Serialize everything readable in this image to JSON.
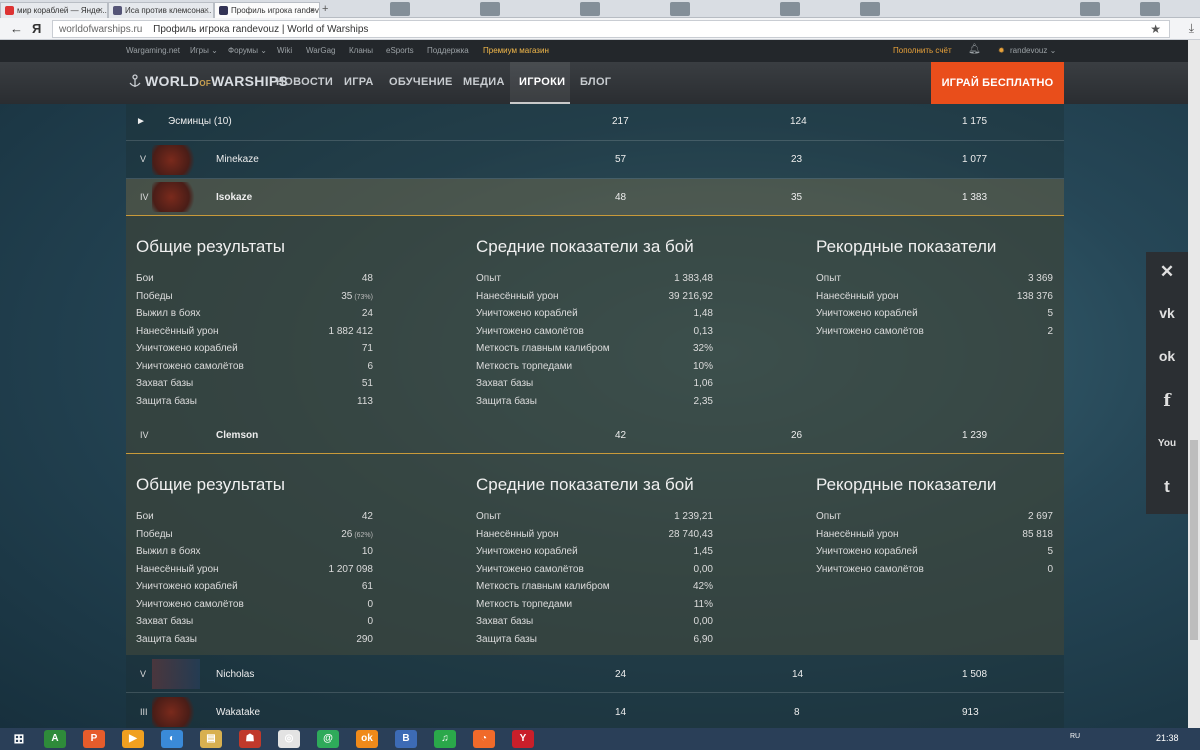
{
  "browser": {
    "tabs": [
      {
        "label": "мир кораблей — Янде...",
        "active": false
      },
      {
        "label": "Иса против клемсона...",
        "active": false
      },
      {
        "label": "Профиль игрока randevouz",
        "active": true
      }
    ],
    "nav_back": "←",
    "nav_ya": "Я",
    "domain": "worldofwarships.ru",
    "title": "Профиль игрока randevouz | World of Warships",
    "star": "★",
    "download": "⤓"
  },
  "wgbar": {
    "wargaming": "Wargaming.net",
    "games": "Игры ⌄",
    "forums": "Форумы ⌄",
    "wiki": "Wiki",
    "wargag": "WarGag",
    "clans": "Кланы",
    "esports": "eSports",
    "support": "Поддержка",
    "premium": "Премиум магазин",
    "topup": "Пополнить счёт",
    "user": "randevouz ⌄"
  },
  "mainnav": {
    "logo_a": "WORLD",
    "logo_of": "OF",
    "logo_b": "WARSHIPS",
    "items": [
      "НОВОСТИ",
      "ИГРА",
      "ОБУЧЕНИЕ",
      "МЕДИА",
      "ИГРОКИ",
      "БЛОГ"
    ],
    "play": "ИГРАЙ БЕСПЛАТНО"
  },
  "table": {
    "group": {
      "label": "Эсминцы (10)",
      "arrow": "►",
      "c1": "217",
      "c2": "124",
      "c3": "1 175"
    },
    "ships": [
      {
        "tier": "V",
        "name": "Minekaze",
        "c1": "57",
        "c2": "23",
        "c3": "1 077"
      },
      {
        "tier": "IV",
        "name": "Isokaze",
        "c1": "48",
        "c2": "35",
        "c3": "1 383"
      },
      {
        "tier": "IV",
        "name": "Clemson",
        "c1": "42",
        "c2": "26",
        "c3": "1 239"
      },
      {
        "tier": "V",
        "name": "Nicholas",
        "c1": "24",
        "c2": "14",
        "c3": "1 508"
      },
      {
        "tier": "III",
        "name": "Wakatake",
        "c1": "14",
        "c2": "8",
        "c3": "913"
      }
    ]
  },
  "headings": {
    "general": "Общие результаты",
    "average": "Средние показатели за бой",
    "records": "Рекордные показатели"
  },
  "isokaze": {
    "general": [
      {
        "label": "Бои",
        "value": "48"
      },
      {
        "label": "Победы",
        "value": "35",
        "pct": "(73%)"
      },
      {
        "label": "Выжил в боях",
        "value": "24"
      },
      {
        "label": "Нанесённый урон",
        "value": "1 882 412"
      },
      {
        "label": "Уничтожено кораблей",
        "value": "71"
      },
      {
        "label": "Уничтожено самолётов",
        "value": "6"
      },
      {
        "label": "Захват базы",
        "value": "51"
      },
      {
        "label": "Защита базы",
        "value": "113"
      }
    ],
    "average": [
      {
        "label": "Опыт",
        "value": "1 383,48"
      },
      {
        "label": "Нанесённый урон",
        "value": "39 216,92"
      },
      {
        "label": "Уничтожено кораблей",
        "value": "1,48"
      },
      {
        "label": "Уничтожено самолётов",
        "value": "0,13"
      },
      {
        "label": "Меткость главным калибром",
        "value": "32%"
      },
      {
        "label": "Меткость торпедами",
        "value": "10%"
      },
      {
        "label": "Захват базы",
        "value": "1,06"
      },
      {
        "label": "Защита базы",
        "value": "2,35"
      }
    ],
    "records": [
      {
        "label": "Опыт",
        "value": "3 369"
      },
      {
        "label": "Нанесённый урон",
        "value": "138 376"
      },
      {
        "label": "Уничтожено кораблей",
        "value": "5"
      },
      {
        "label": "Уничтожено самолётов",
        "value": "2"
      }
    ]
  },
  "clemson": {
    "general": [
      {
        "label": "Бои",
        "value": "42"
      },
      {
        "label": "Победы",
        "value": "26",
        "pct": "(62%)"
      },
      {
        "label": "Выжил в боях",
        "value": "10"
      },
      {
        "label": "Нанесённый урон",
        "value": "1 207 098"
      },
      {
        "label": "Уничтожено кораблей",
        "value": "61"
      },
      {
        "label": "Уничтожено самолётов",
        "value": "0"
      },
      {
        "label": "Захват базы",
        "value": "0"
      },
      {
        "label": "Защита базы",
        "value": "290"
      }
    ],
    "average": [
      {
        "label": "Опыт",
        "value": "1 239,21"
      },
      {
        "label": "Нанесённый урон",
        "value": "28 740,43"
      },
      {
        "label": "Уничтожено кораблей",
        "value": "1,45"
      },
      {
        "label": "Уничтожено самолётов",
        "value": "0,00"
      },
      {
        "label": "Меткость главным калибром",
        "value": "42%"
      },
      {
        "label": "Меткость торпедами",
        "value": "11%"
      },
      {
        "label": "Захват базы",
        "value": "0,00"
      },
      {
        "label": "Защита базы",
        "value": "6,90"
      }
    ],
    "records": [
      {
        "label": "Опыт",
        "value": "2 697"
      },
      {
        "label": "Нанесённый урон",
        "value": "85 818"
      },
      {
        "label": "Уничтожено кораблей",
        "value": "5"
      },
      {
        "label": "Уничтожено самолётов",
        "value": "0"
      }
    ]
  },
  "social": {
    "close": "✕",
    "vk": "vk",
    "ok": "ok",
    "fb": "f",
    "yt": "You",
    "tw": "t"
  },
  "taskbar": {
    "lang": "RU",
    "time": "21:38",
    "apps": [
      "A",
      "P",
      "▶",
      "◐",
      "▤",
      "☗",
      "◎",
      "@",
      "ok",
      "B",
      "♫",
      "◔",
      "Y"
    ]
  }
}
